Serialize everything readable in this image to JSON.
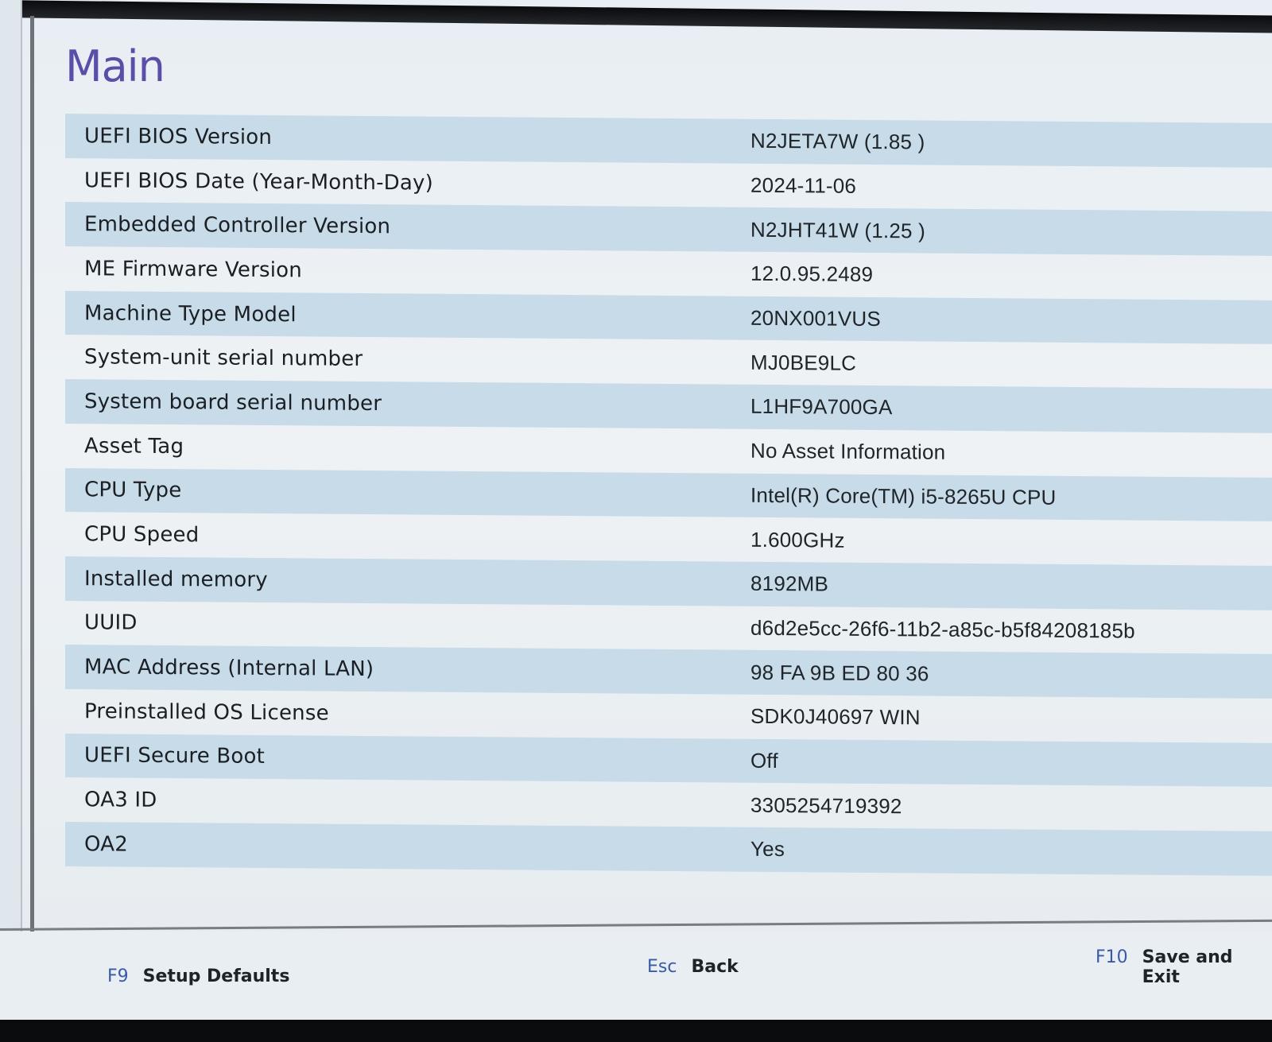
{
  "title": "Main",
  "rows": [
    {
      "label": "UEFI BIOS Version",
      "value": "N2JETA7W (1.85 )"
    },
    {
      "label": "UEFI BIOS Date (Year-Month-Day)",
      "value": "2024-11-06"
    },
    {
      "label": "Embedded Controller Version",
      "value": "N2JHT41W (1.25 )"
    },
    {
      "label": "ME Firmware Version",
      "value": "12.0.95.2489"
    },
    {
      "label": "Machine Type Model",
      "value": "20NX001VUS"
    },
    {
      "label": "System-unit serial number",
      "value": "MJ0BE9LC"
    },
    {
      "label": "System board serial number",
      "value": "L1HF9A700GA"
    },
    {
      "label": "Asset Tag",
      "value": "No Asset Information"
    },
    {
      "label": "CPU Type",
      "value": "Intel(R) Core(TM) i5-8265U CPU"
    },
    {
      "label": "CPU Speed",
      "value": "1.600GHz"
    },
    {
      "label": "Installed memory",
      "value": "8192MB"
    },
    {
      "label": "UUID",
      "value": "d6d2e5cc-26f6-11b2-a85c-b5f84208185b"
    },
    {
      "label": "MAC Address (Internal LAN)",
      "value": "98 FA 9B ED 80 36"
    },
    {
      "label": "Preinstalled OS License",
      "value": "SDK0J40697 WIN"
    },
    {
      "label": "UEFI Secure Boot",
      "value": "Off"
    },
    {
      "label": "OA3 ID",
      "value": "3305254719392"
    },
    {
      "label": "OA2",
      "value": "Yes"
    }
  ],
  "footer": {
    "setup_defaults": {
      "key": "F9",
      "action": "Setup Defaults"
    },
    "back": {
      "key": "Esc",
      "action": "Back"
    },
    "save_exit": {
      "key": "F10",
      "action": "Save and Exit"
    }
  },
  "colors": {
    "title": "#5a4ea8",
    "row_shaded": "#c7dbe9",
    "hotkey": "#3a5aa8"
  }
}
